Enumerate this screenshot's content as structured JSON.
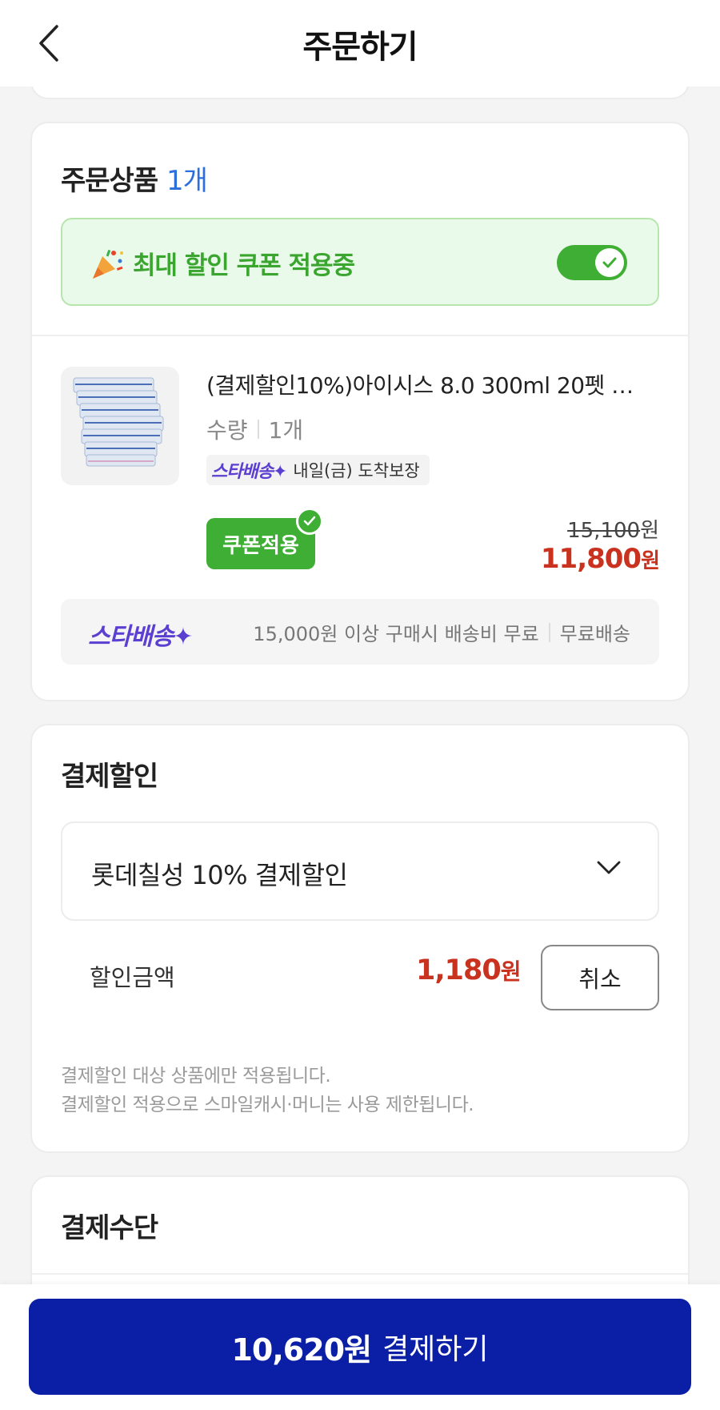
{
  "header": {
    "title": "주문하기"
  },
  "order": {
    "title": "주문상품",
    "count": "1개",
    "coupon_banner": {
      "text": "최대 할인 쿠폰 적용중",
      "toggle_on": true
    },
    "product": {
      "name": "(결제할인10%)아이시스 8.0 300ml 20펫 …",
      "qty_label": "수량",
      "qty_value": "1개",
      "delivery_badge_logo": "스타배송✦",
      "delivery_badge_text": "내일(금) 도착보장",
      "coupon_chip": "쿠폰적용",
      "original_price": "15,100",
      "original_unit": "원",
      "sale_price": "11,800",
      "sale_unit": "원"
    },
    "shipping": {
      "logo": "스타배송✦",
      "condition": "15,000원 이상 구매시 배송비 무료",
      "fee": "무료배송"
    }
  },
  "discount": {
    "title": "결제할인",
    "selected": "롯데칠성 10% 결제할인",
    "amount_label": "할인금액",
    "amount": "1,180",
    "amount_unit": "원",
    "cancel_label": "취소",
    "note1": "결제할인 대상 상품에만 적용됩니다.",
    "note2": "결제할인 적용으로 스마일캐시·머니는 사용 제한됩니다."
  },
  "payment": {
    "title": "결제수단"
  },
  "bottom": {
    "amount": "10,620원",
    "label": "결제하기"
  },
  "colors": {
    "accent_blue": "#0b1fa6",
    "sale_red": "#c8321e",
    "coupon_green": "#3fae34",
    "count_blue": "#2b6fdb",
    "star_purple": "#5b3fd1"
  }
}
